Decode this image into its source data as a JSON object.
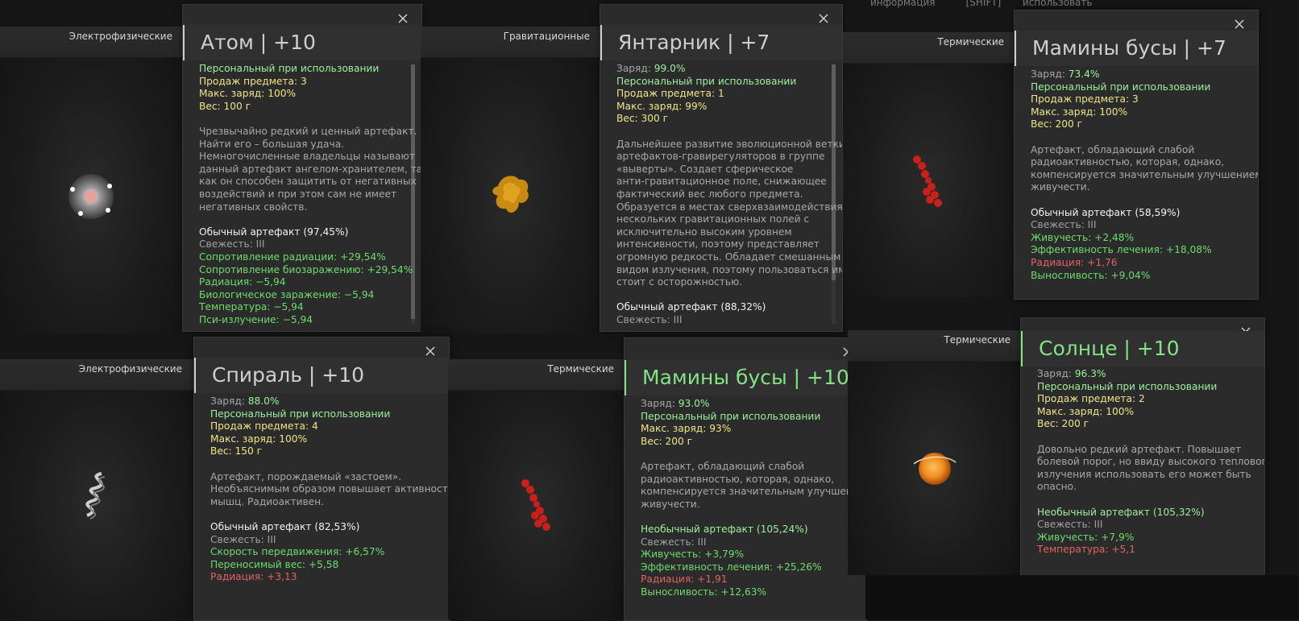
{
  "hud": {
    "info": "информация",
    "shift": "[SHIFT]",
    "use": "использовать"
  },
  "cards": [
    {
      "category": "Электрофизические",
      "title": "Атом | +10",
      "stats": [
        {
          "label": "",
          "value": "Персональный при использовании",
          "color": "green"
        },
        {
          "label": "",
          "value": "Продаж предмета: 3",
          "color": "yellow"
        },
        {
          "label": "",
          "value": "Макс. заряд: 100%",
          "color": "yellow"
        },
        {
          "label": "",
          "value": "Вес: 100 г",
          "color": "yellow"
        }
      ],
      "description": [
        "Чрезвычайно редкий и ценный артефакт.",
        "Найти его – большая удача.",
        "Немногочисленные владельцы называют",
        "данный артефакт ангелом-хранителем, так",
        "как он способен защитить от негативных",
        "воздействий и при этом сам не имеет",
        "негативных свойств."
      ],
      "quality": "Обычный артефакт (97,45%)",
      "freshness": "Свежесть: III",
      "effects": [
        {
          "text": "Сопротивление радиации: +29,54%",
          "color": "green"
        },
        {
          "text": "Сопротивление биозаражению: +29,54%",
          "color": "green"
        },
        {
          "text": "Радиация: −5,94",
          "color": "green"
        },
        {
          "text": "Биологическое заражение: −5,94",
          "color": "green"
        },
        {
          "text": "Температура: −5,94",
          "color": "green"
        },
        {
          "text": "Пси-излучение: −5,94",
          "color": "green"
        }
      ]
    },
    {
      "category": "Гравитационные",
      "title": "Янтарник | +7",
      "stats": [
        {
          "label": "Заряд: ",
          "value": "99.0%",
          "color": "green"
        },
        {
          "label": "",
          "value": "Персональный при использовании",
          "color": "green"
        },
        {
          "label": "",
          "value": "Продаж предмета: 1",
          "color": "yellow"
        },
        {
          "label": "",
          "value": "Макс. заряд: 99%",
          "color": "yellow"
        },
        {
          "label": "",
          "value": "Вес: 300 г",
          "color": "yellow"
        }
      ],
      "description": [
        "Дальнейшее развитие эволюционной ветки",
        "артефактов-гравирегуляторов в группе",
        "«выверты». Создает сферическое",
        "анти-гравитационное поле, снижающее",
        "фактический вес любого предмета.",
        "Образуется в местах сверхвзаимодействия",
        "нескольких гравитационных полей с",
        "исключительно высоким уровнем",
        "интенсивности, поэтому представляет",
        "огромную редкость. Обладает смешанным",
        "видом излучения, поэтому пользоваться им",
        "стоит с осторожностью."
      ],
      "quality": "Обычный артефакт (88,32%)",
      "freshness": "Свежесть: III",
      "effects": []
    },
    {
      "category": "Термические",
      "title": "Мамины бусы | +7",
      "stats": [
        {
          "label": "Заряд: ",
          "value": "73.4%",
          "color": "green"
        },
        {
          "label": "",
          "value": "Персональный при использовании",
          "color": "green"
        },
        {
          "label": "",
          "value": "Продаж предмета: 3",
          "color": "yellow"
        },
        {
          "label": "",
          "value": "Макс. заряд: 100%",
          "color": "yellow"
        },
        {
          "label": "",
          "value": "Вес: 200 г",
          "color": "yellow"
        }
      ],
      "description": [
        "Артефакт, обладающий слабой",
        "радиоактивностью, которая, однако,",
        "компенсируется значительным улучшением",
        "живучести."
      ],
      "quality": "Обычный артефакт (58,59%)",
      "freshness": "Свежесть: III",
      "effects": [
        {
          "text": "Живучесть: +2,48%",
          "color": "green"
        },
        {
          "text": "Эффективность лечения: +18,08%",
          "color": "green"
        },
        {
          "text": "Радиация: +1,76",
          "color": "red"
        },
        {
          "text": "Выносливость: +9,04%",
          "color": "green"
        }
      ]
    },
    {
      "category": "Электрофизические",
      "title": "Спираль | +10",
      "stats": [
        {
          "label": "Заряд: ",
          "value": "88.0%",
          "color": "green"
        },
        {
          "label": "",
          "value": "Персональный при использовании",
          "color": "green"
        },
        {
          "label": "",
          "value": "Продаж предмета: 4",
          "color": "yellow"
        },
        {
          "label": "",
          "value": "Макс. заряд: 100%",
          "color": "yellow"
        },
        {
          "label": "",
          "value": "Вес: 150 г",
          "color": "yellow"
        }
      ],
      "description": [
        "Артефакт, порождаемый «застоем».",
        "Необъяснимым образом повышает активность",
        "мышц. Радиоактивен."
      ],
      "quality": "Обычный артефакт (82,53%)",
      "freshness": "Свежесть: III",
      "effects": [
        {
          "text": "Скорость передвижения: +6,57%",
          "color": "green"
        },
        {
          "text": "Переносимый вес: +5,58",
          "color": "green"
        },
        {
          "text": "Радиация: +3,13",
          "color": "red"
        }
      ]
    },
    {
      "category": "Термические",
      "title": "Мамины бусы | +10",
      "stats": [
        {
          "label": "Заряд: ",
          "value": "93.0%",
          "color": "green"
        },
        {
          "label": "",
          "value": "Персональный при использовании",
          "color": "green"
        },
        {
          "label": "",
          "value": "Макс. заряд: 93%",
          "color": "yellow"
        },
        {
          "label": "",
          "value": "Вес: 200 г",
          "color": "yellow"
        }
      ],
      "description": [
        "Артефакт, обладающий слабой",
        "радиоактивностью, которая, однако,",
        "компенсируется значительным улучшением",
        "живучести."
      ],
      "quality": "Необычный артефакт (105,24%)",
      "freshness": "Свежесть: III",
      "effects": [
        {
          "text": "Живучесть: +3,79%",
          "color": "green"
        },
        {
          "text": "Эффективность лечения: +25,26%",
          "color": "green"
        },
        {
          "text": "Радиация: +1,91",
          "color": "red"
        },
        {
          "text": "Выносливость: +12,63%",
          "color": "green"
        }
      ]
    },
    {
      "category": "Термические",
      "title": "Солнце | +10",
      "stats": [
        {
          "label": "Заряд: ",
          "value": "96.3%",
          "color": "green"
        },
        {
          "label": "",
          "value": "Персональный при использовании",
          "color": "green"
        },
        {
          "label": "",
          "value": "Продаж предмета: 2",
          "color": "yellow"
        },
        {
          "label": "",
          "value": "Макс. заряд: 100%",
          "color": "yellow"
        },
        {
          "label": "",
          "value": "Вес: 200 г",
          "color": "yellow"
        }
      ],
      "description": [
        "Довольно редкий артефакт. Повышает",
        "болевой порог, но ввиду высокого теплового",
        "излучения использовать его может быть",
        "опасно."
      ],
      "quality": "Необычный артефакт (105,32%)",
      "freshness": "Свежесть: III",
      "effects": [
        {
          "text": "Живучесть: +7,9%",
          "color": "green"
        },
        {
          "text": "Температура: +5,1",
          "color": "red"
        }
      ]
    }
  ],
  "colors": {
    "green": "#6edc6e",
    "yellow": "#f0e48a",
    "red": "#e06464",
    "title_gray": "#cfcfcf",
    "title_green": "#86e286"
  }
}
